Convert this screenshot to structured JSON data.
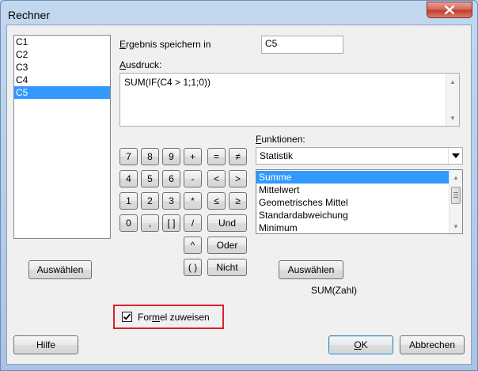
{
  "window": {
    "title": "Rechner",
    "close_icon": "close-x-icon"
  },
  "columns": [
    {
      "label": "C1",
      "selected": false
    },
    {
      "label": "C2",
      "selected": false
    },
    {
      "label": "C3",
      "selected": false
    },
    {
      "label": "C4",
      "selected": false
    },
    {
      "label": "C5",
      "selected": true
    }
  ],
  "store_result": {
    "label_accel": "E",
    "label_rest": "rgebnis speichern in",
    "value": "C5"
  },
  "expression": {
    "label_accel": "A",
    "label_rest": "usdruck:",
    "value": "SUM(IF(C4 > 1;1;0))"
  },
  "keypad": {
    "k7": "7",
    "k8": "8",
    "k9": "9",
    "plus": "+",
    "eq": "=",
    "neq": "≠",
    "k4": "4",
    "k5": "5",
    "k6": "6",
    "minus": "-",
    "lt": "<",
    "gt": ">",
    "k1": "1",
    "k2": "2",
    "k3": "3",
    "mul": "*",
    "le": "≤",
    "ge": "≥",
    "k0": "0",
    "comma": ",",
    "brackets": "[ ]",
    "div": "/",
    "und": "Und",
    "pow": "^",
    "oder": "Oder",
    "parens": "( )",
    "nicht": "Nicht"
  },
  "functions": {
    "label_accel": "F",
    "label_rest": "unktionen:",
    "category": "Statistik",
    "items": [
      "Summe",
      "Mittelwert",
      "Geometrisches Mittel",
      "Standardabweichung",
      "Minimum"
    ],
    "selected_index": 0,
    "syntax": "SUM(Zahl)"
  },
  "buttons": {
    "select_left": "Auswählen",
    "select_right": "Auswählen",
    "help": "Hilfe",
    "ok_accel": "O",
    "ok_rest": "K",
    "cancel": "Abbrechen"
  },
  "assign_formula": {
    "checked": true,
    "label_pre": "For",
    "label_accel": "m",
    "label_post": "el zuweisen"
  },
  "colors": {
    "highlight": "#d9232d",
    "selection": "#3399ff",
    "close_button": "#c13c2c"
  }
}
